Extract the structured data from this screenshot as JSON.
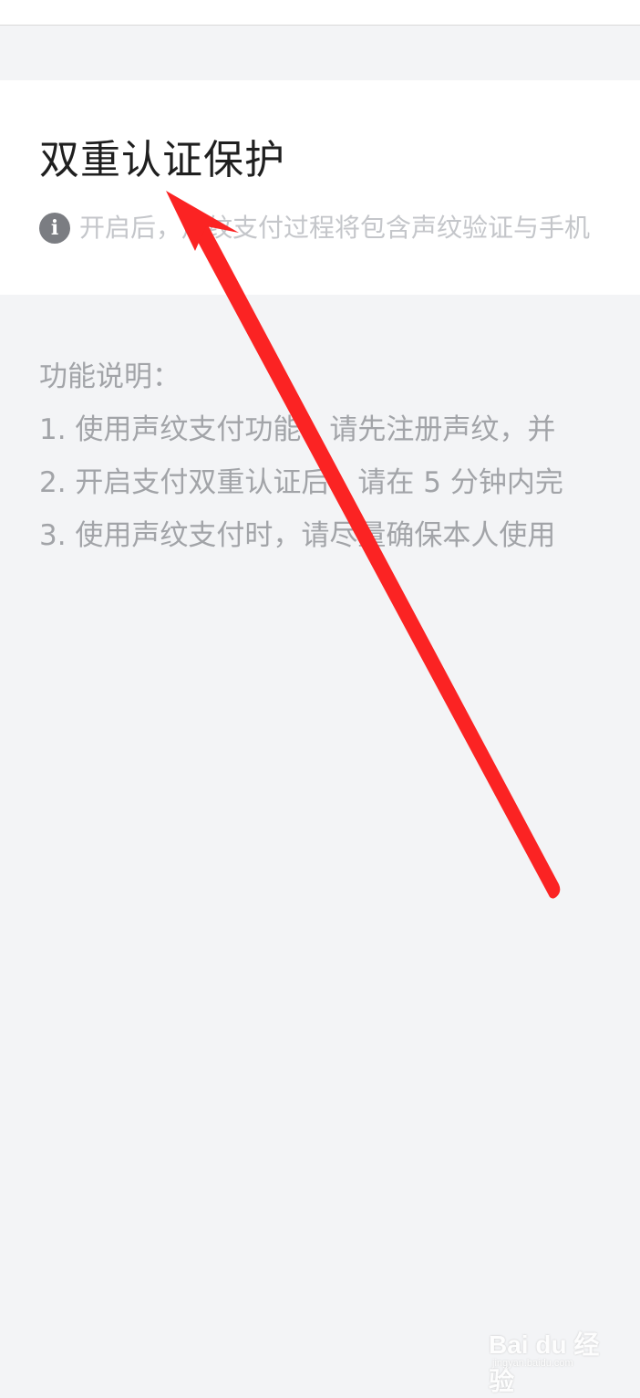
{
  "card": {
    "title": "双重认证保护",
    "info_icon": "info-icon",
    "info_text": "开启后，声纹支付过程将包含声纹验证与手机"
  },
  "description": {
    "heading": "功能说明：",
    "lines": [
      "1. 使用声纹支付功能，请先注册声纹，并",
      "2. 开启支付双重认证后，请在 5 分钟内完",
      "3. 使用声纹支付时，请尽量确保本人使用"
    ]
  },
  "annotation": {
    "type": "red-arrow",
    "color": "#fb2323",
    "points_to": "card-title"
  },
  "watermark": {
    "logo": "Bai du 经验",
    "url": "jingyan.baidu.com"
  }
}
